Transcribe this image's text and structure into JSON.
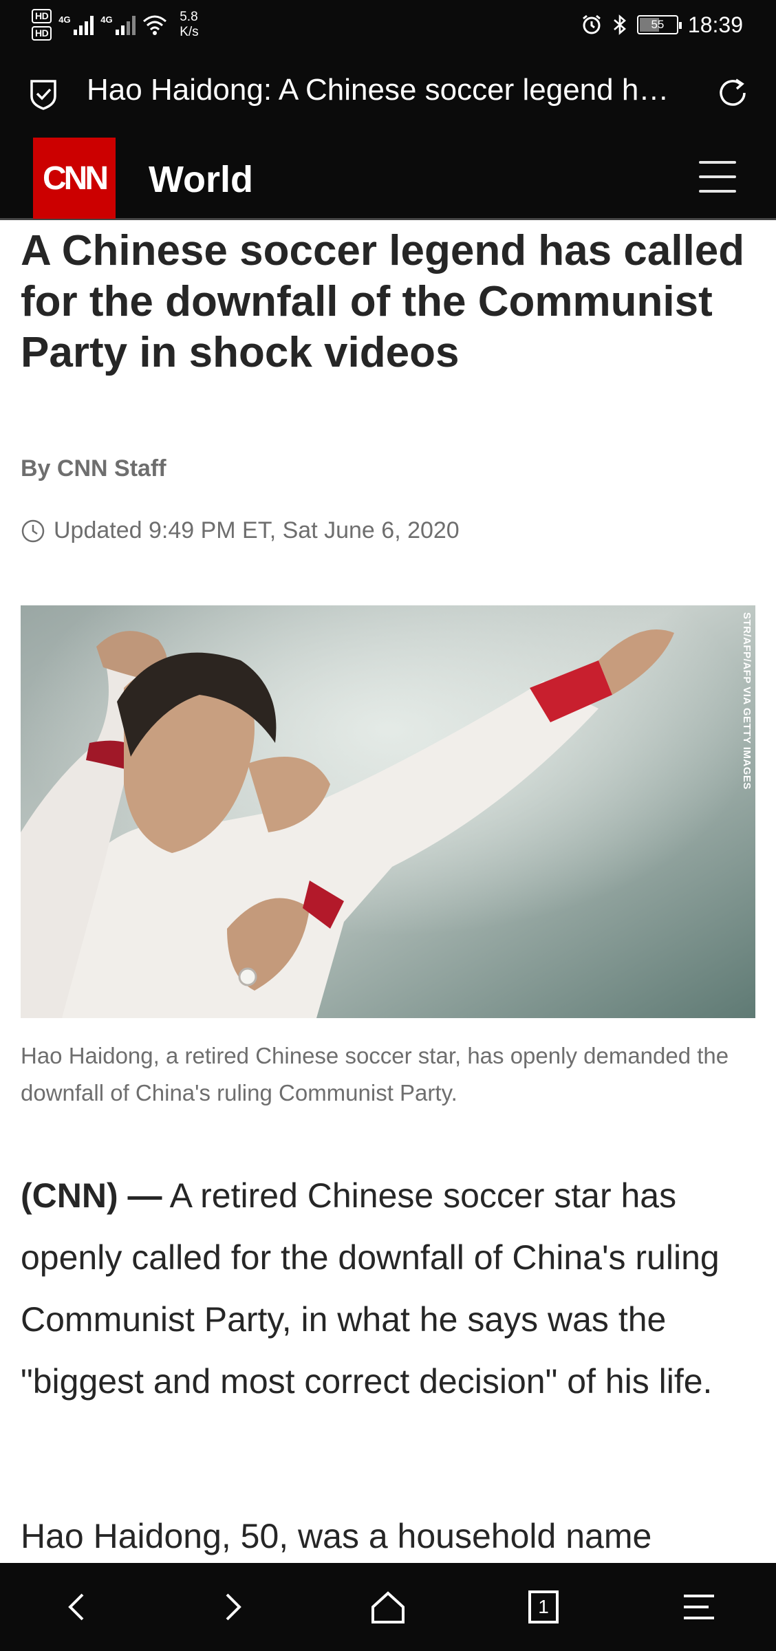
{
  "status_bar": {
    "hd1": "HD",
    "hd2": "HD",
    "signal1_label": "4G",
    "signal2_label": "4G",
    "net_speed_value": "5.8",
    "net_speed_unit": "K/s",
    "battery": "55",
    "time": "18:39"
  },
  "browser": {
    "page_title": "Hao Haidong: A Chinese soccer legend has called for the downfall of the Communist Party in shock videos",
    "tab_count": "1"
  },
  "cnn_header": {
    "logo_text": "CNN",
    "section": "World"
  },
  "article": {
    "headline": "A Chinese soccer legend has called for the downfall of the Communist Party in shock videos",
    "byline": "By CNN Staff",
    "updated": "Updated 9:49 PM ET, Sat June 6, 2020",
    "image_credit": "STR/AFP/AFP VIA GETTY IMAGES",
    "caption": "Hao Haidong, a retired Chinese soccer star, has openly demanded the downfall of China's ruling Communist Party.",
    "dateline": "(CNN) —",
    "paragraph1": " A retired Chinese soccer star has openly called for the downfall of China's ruling Communist Party, in what he says was the \"biggest and most correct decision\" of his life.",
    "paragraph2": "Hao Haidong, 50, was a household name"
  },
  "icons": {
    "shield": "shield-check-icon",
    "reload": "reload-icon",
    "menu": "hamburger-menu-icon",
    "clock": "clock-icon",
    "back": "back-arrow-icon",
    "forward": "forward-arrow-icon",
    "home": "home-icon",
    "tabs": "tabs-icon",
    "browser_menu": "browser-menu-icon"
  },
  "colors": {
    "cnn_red": "#cc0000",
    "bar_background": "#0b0b0b",
    "headline_text": "#262626",
    "meta_text": "#6e6e6e"
  }
}
